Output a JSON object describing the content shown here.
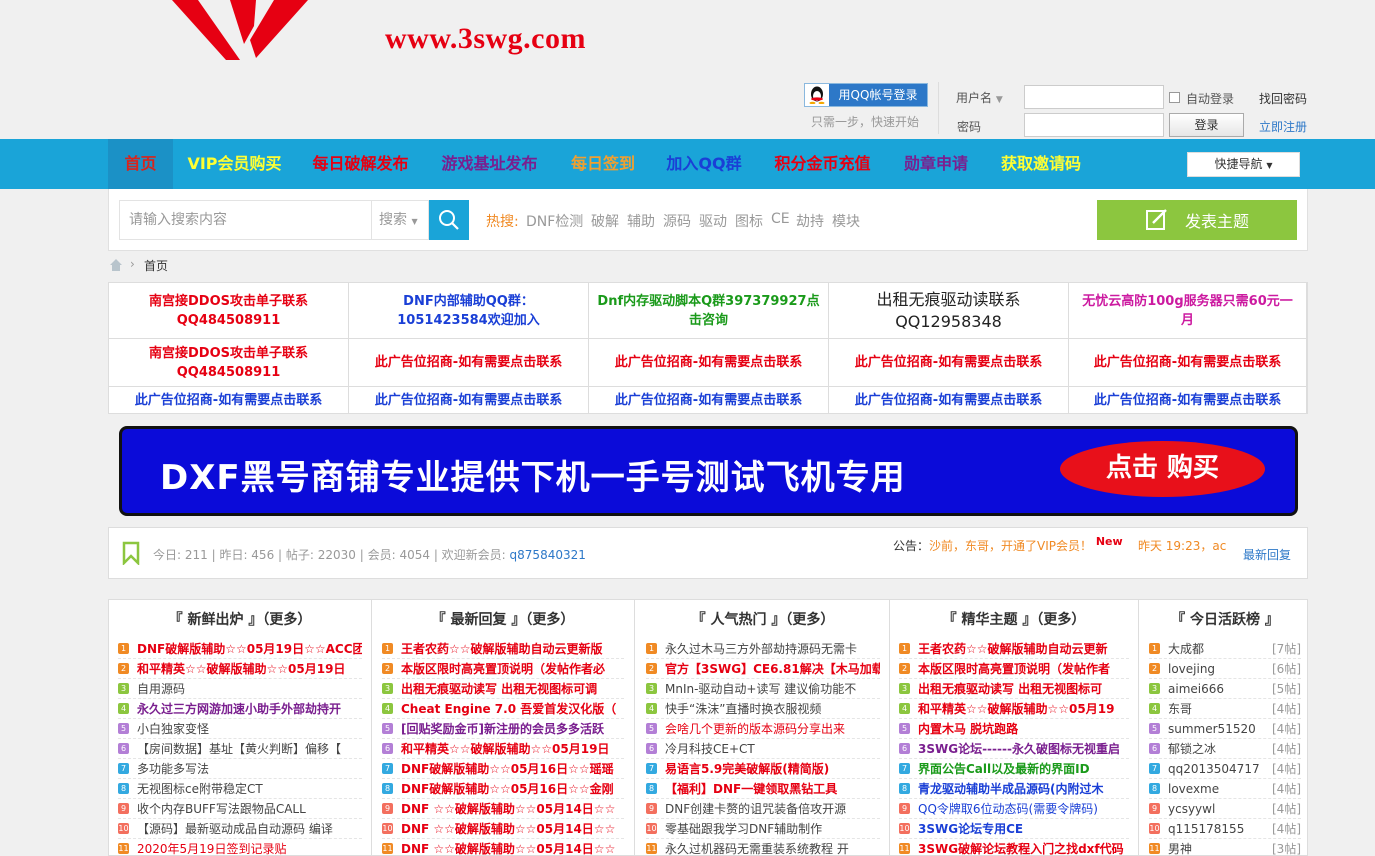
{
  "header": {
    "site_url": "www.3swg.com",
    "qq_login_label": "用QQ帐号登录",
    "qq_tip": "只需一步，快速开始",
    "username_label": "用户名",
    "password_label": "密码",
    "auto_login_label": "自动登录",
    "find_password_label": "找回密码",
    "login_button": "登录",
    "register_link": "立即注册"
  },
  "nav": {
    "items": [
      {
        "label": "首页",
        "color": "#d8241c"
      },
      {
        "label": "VIP会员购买",
        "color": "#ffff33"
      },
      {
        "label": "每日破解发布",
        "color": "#e60012"
      },
      {
        "label": "游戏基址发布",
        "color": "#7a1f8f"
      },
      {
        "label": "每日签到",
        "color": "#f0a030"
      },
      {
        "label": "加入QQ群",
        "color": "#1a3fd6"
      },
      {
        "label": "积分金币充值",
        "color": "#e60012"
      },
      {
        "label": "勋章申请",
        "color": "#7a1f8f"
      },
      {
        "label": "获取邀请码",
        "color": "#ffff33"
      }
    ],
    "quick_nav": "快捷导航"
  },
  "search": {
    "placeholder": "请输入搜索内容",
    "type": "搜索",
    "hot_label": "热搜:",
    "hot_words": [
      "DNF检测",
      "破解",
      "辅助",
      "源码",
      "驱动",
      "图标",
      "CE",
      "劫持",
      "模块"
    ],
    "post_button": "发表主题"
  },
  "breadcrumb": {
    "current": "首页"
  },
  "ads": [
    [
      {
        "text": "南宫接DDOS攻击单子联系QQ484508911",
        "color": "#e60012"
      },
      {
        "text": "DNF内部辅助QQ群： 1051423584欢迎加入",
        "color": "#1a3fd6"
      },
      {
        "text": "Dnf内存驱动脚本Q群397379927点击咨询",
        "color": "#1a9a1a"
      },
      {
        "text": "出租无痕驱动读联系QQ12958348",
        "color": "#222222"
      },
      {
        "text": "无忧云高防100g服务器只需60元一月",
        "color": "#cc1aa0"
      }
    ],
    [
      {
        "text": "南宫接DDOS攻击单子联系QQ484508911",
        "color": "#e60012"
      },
      {
        "text": "此广告位招商-如有需要点击联系",
        "color": "#e60012"
      },
      {
        "text": "此广告位招商-如有需要点击联系",
        "color": "#e60012"
      },
      {
        "text": "此广告位招商-如有需要点击联系",
        "color": "#e60012"
      },
      {
        "text": "此广告位招商-如有需要点击联系",
        "color": "#e60012"
      }
    ],
    [
      {
        "text": "此广告位招商-如有需要点击联系",
        "color": "#1a3fd6"
      },
      {
        "text": "此广告位招商-如有需要点击联系",
        "color": "#1a3fd6"
      },
      {
        "text": "此广告位招商-如有需要点击联系",
        "color": "#1a3fd6"
      },
      {
        "text": "此广告位招商-如有需要点击联系",
        "color": "#1a3fd6"
      },
      {
        "text": "此广告位招商-如有需要点击联系",
        "color": "#1a3fd6"
      }
    ]
  ],
  "banner": {
    "text": "DXF黑号商铺专业提供下机一手号测试飞机专用",
    "button": "点击 购买"
  },
  "stats": {
    "today": "今日: 211",
    "yesterday": "昨日: 456",
    "posts": "帖子: 22030",
    "members": "会员: 4054",
    "welcome": "欢迎新会员:",
    "new_member": "q875840321",
    "announce_label": "公告：",
    "announce_text": "沙前，东哥，开通了VIP会员！",
    "new_tag": "New",
    "announce_time": "昨天 19:23，ac",
    "last_reply": "最新回复"
  },
  "columns": [
    {
      "title": "『 新鲜出炉 』（更多）",
      "rows": [
        {
          "text": "DNF破解版辅助☆☆05月19日☆☆ACC团",
          "color": "#e60012",
          "bold": true
        },
        {
          "text": "和平精英☆☆破解版辅助☆☆05月19日",
          "color": "#e60012",
          "bold": true
        },
        {
          "text": "自用源码",
          "color": "#444444",
          "bold": false
        },
        {
          "text": "永久过三方网游加速小助手外部劫持开",
          "color": "#7a1f8f",
          "bold": true
        },
        {
          "text": "小白独家变怪",
          "color": "#444444",
          "bold": false
        },
        {
          "text": "【房间数据】基址【黄火判断】偏移【",
          "color": "#444444",
          "bold": false
        },
        {
          "text": "多功能多写法",
          "color": "#444444",
          "bold": false
        },
        {
          "text": "无视图标ce附带稳定CT",
          "color": "#444444",
          "bold": false
        },
        {
          "text": "收个内存BUFF写法跟物品CALL",
          "color": "#444444",
          "bold": false
        },
        {
          "text": "【源码】最新驱动成品自动源码 编译",
          "color": "#444444",
          "bold": false
        },
        {
          "text": "2020年5月19日签到记录贴",
          "color": "#e60012",
          "bold": false
        }
      ]
    },
    {
      "title": "『 最新回复 』（更多）",
      "rows": [
        {
          "text": "王者农药☆☆破解版辅助自动云更新版",
          "color": "#e60012",
          "bold": true
        },
        {
          "text": "本版区限时高亮置顶说明（发帖作者必",
          "color": "#e60012",
          "bold": true
        },
        {
          "text": "出租无痕驱动读写 出租无视图标可调",
          "color": "#e60012",
          "bold": true
        },
        {
          "text": "Cheat Engine 7.0 吾爱首发汉化版（",
          "color": "#e60012",
          "bold": true
        },
        {
          "text": "[回贴奖励金币]新注册的会员多多活跃",
          "color": "#7a1f8f",
          "bold": true
        },
        {
          "text": "和平精英☆☆破解版辅助☆☆05月19日",
          "color": "#e60012",
          "bold": true
        },
        {
          "text": "DNF破解版辅助☆☆05月16日☆☆瑶瑶",
          "color": "#e60012",
          "bold": true
        },
        {
          "text": "DNF破解版辅助☆☆05月16日☆☆金刚",
          "color": "#e60012",
          "bold": true
        },
        {
          "text": "DNF ☆☆破解版辅助☆☆05月14日☆☆",
          "color": "#e60012",
          "bold": true
        },
        {
          "text": "DNF ☆☆破解版辅助☆☆05月14日☆☆",
          "color": "#e60012",
          "bold": true
        },
        {
          "text": "DNF ☆☆破解版辅助☆☆05月14日☆☆",
          "color": "#e60012",
          "bold": true
        }
      ]
    },
    {
      "title": "『 人气热门 』（更多）",
      "rows": [
        {
          "text": "永久过木马三方外部劫持源码无需卡",
          "color": "#444444",
          "bold": false
        },
        {
          "text": "官方【3SWG】CE6.81解决【木马加载",
          "color": "#e60012",
          "bold": true
        },
        {
          "text": "MnIn-驱动自动+读写 建议偷功能不",
          "color": "#444444",
          "bold": false
        },
        {
          "text": "快手“洙沫”直播时换衣服视频",
          "color": "#444444",
          "bold": false
        },
        {
          "text": "会啥几个更新的版本源码分享出来",
          "color": "#e60012",
          "bold": false
        },
        {
          "text": "冷月科技CE+CT",
          "color": "#444444",
          "bold": false
        },
        {
          "text": "易语言5.9完美破解版(精简版)",
          "color": "#e60012",
          "bold": true
        },
        {
          "text": "【福利】DNF一键领取黑钻工具",
          "color": "#e60012",
          "bold": true
        },
        {
          "text": "DNF创建卡赘的诅咒装备倍攻开源",
          "color": "#444444",
          "bold": false
        },
        {
          "text": "零基础跟我学习DNF辅助制作",
          "color": "#444444",
          "bold": false
        },
        {
          "text": "永久过机器码无需重装系统教程 开",
          "color": "#444444",
          "bold": false
        }
      ]
    },
    {
      "title": "『 精华主题 』（更多）",
      "rows": [
        {
          "text": "王者农药☆☆破解版辅助自动云更新",
          "color": "#e60012",
          "bold": true
        },
        {
          "text": "本版区限时高亮置顶说明（发帖作者",
          "color": "#e60012",
          "bold": true
        },
        {
          "text": "出租无痕驱动读写 出租无视图标可",
          "color": "#e60012",
          "bold": true
        },
        {
          "text": "和平精英☆☆破解版辅助☆☆05月19",
          "color": "#e60012",
          "bold": true
        },
        {
          "text": "内置木马 脱坑跑路",
          "color": "#e60012",
          "bold": true
        },
        {
          "text": "3SWG论坛------永久破图标无视重启",
          "color": "#7a1f8f",
          "bold": true
        },
        {
          "text": "界面公告Call以及最新的界面ID",
          "color": "#1a9a1a",
          "bold": true
        },
        {
          "text": "青龙驱动辅助半成品源码(内附过木",
          "color": "#1a3fd6",
          "bold": true
        },
        {
          "text": "QQ令牌取6位动态码(需要令牌码)",
          "color": "#1a3fd6",
          "bold": false
        },
        {
          "text": "3SWG论坛专用CE",
          "color": "#1a3fd6",
          "bold": true
        },
        {
          "text": "3SWG破解论坛教程入门之找dxf代码",
          "color": "#e60012",
          "bold": true
        }
      ]
    },
    {
      "title": "『 今日活跃榜 』",
      "rows": [
        {
          "text": "大成都",
          "count": "[7帖]"
        },
        {
          "text": "lovejing",
          "count": "[6帖]"
        },
        {
          "text": "aimei666",
          "count": "[5帖]"
        },
        {
          "text": "东哥",
          "count": "[4帖]"
        },
        {
          "text": "summer51520",
          "count": "[4帖]"
        },
        {
          "text": "郁锁之冰",
          "count": "[4帖]"
        },
        {
          "text": "qq2013504717",
          "count": "[4帖]"
        },
        {
          "text": "lovexme",
          "count": "[4帖]"
        },
        {
          "text": "ycsyywl",
          "count": "[4帖]"
        },
        {
          "text": "q115178155",
          "count": "[4帖]"
        },
        {
          "text": "男神",
          "count": "[3帖]"
        }
      ]
    }
  ],
  "rank_colors": [
    "#f08a24",
    "#f08a24",
    "#8cc63f",
    "#8cc63f",
    "#b37fd6",
    "#b37fd6",
    "#33a9e0",
    "#33a9e0",
    "#f36f5e",
    "#f36f5e",
    "#f08a24"
  ]
}
